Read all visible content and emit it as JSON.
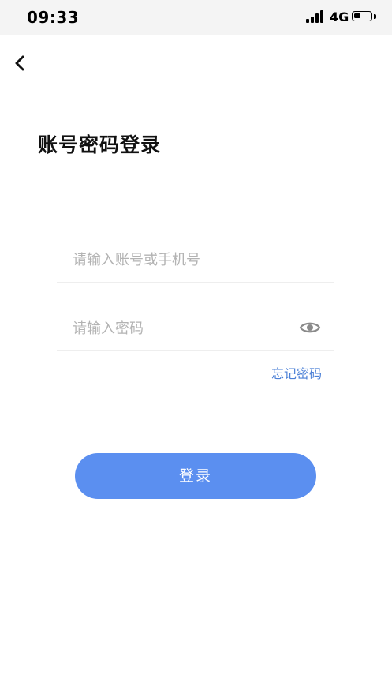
{
  "status_bar": {
    "time": "09:33",
    "network": "4G",
    "battery_level": 0.4
  },
  "header": {
    "back_icon": "chevron-left-icon"
  },
  "title": "账号密码登录",
  "form": {
    "account_placeholder": "请输入账号或手机号",
    "account_value": "",
    "password_placeholder": "请输入密码",
    "password_value": "",
    "password_visibility_icon": "eye-icon",
    "forgot_password": "忘记密码"
  },
  "login_button_label": "登录",
  "colors": {
    "primary": "#5b8ff0",
    "link": "#4a7fd6",
    "placeholder": "#b3b3b3",
    "divider": "#eeeeee"
  }
}
